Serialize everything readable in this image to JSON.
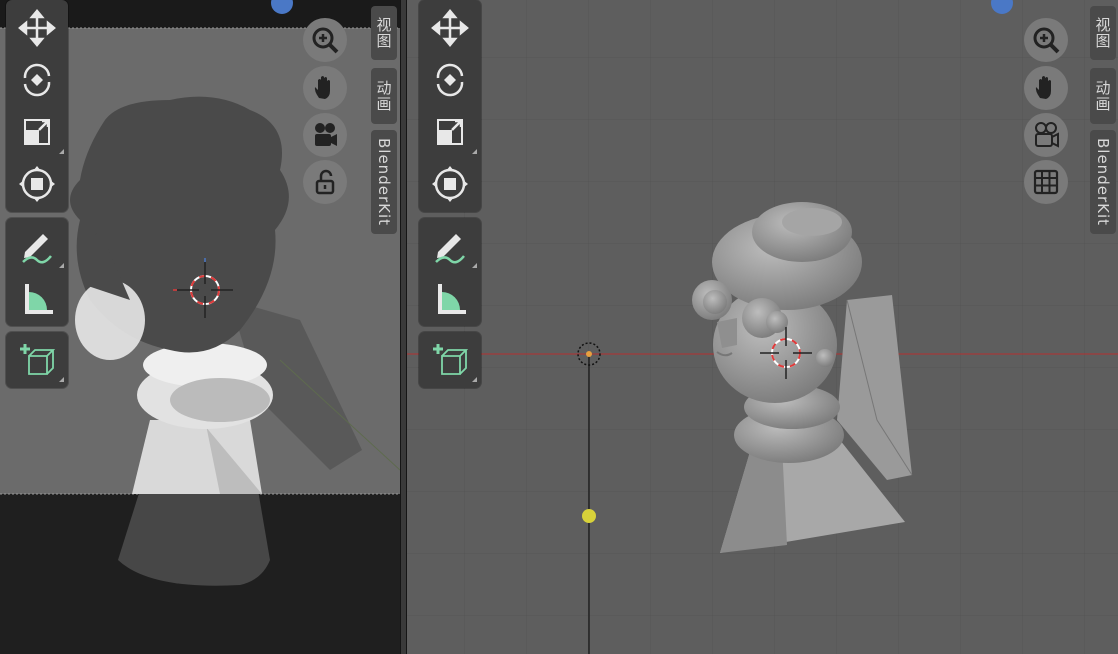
{
  "left_viewport": {
    "tools": [
      "move",
      "rotate",
      "scale",
      "transform",
      "annotate",
      "measure",
      "add-cube"
    ],
    "nav": [
      "zoom",
      "pan",
      "camera",
      "lock"
    ],
    "tabs": {
      "view": "视图",
      "animation": "动画",
      "blenderkit": "BlenderKit"
    }
  },
  "right_viewport": {
    "tools": [
      "move",
      "rotate",
      "scale",
      "transform",
      "annotate",
      "measure",
      "add-cube"
    ],
    "nav": [
      "zoom",
      "pan",
      "camera",
      "grid"
    ],
    "tabs": {
      "view": "视图",
      "animation": "动画",
      "blenderkit": "BlenderKit"
    }
  },
  "colors": {
    "accent_blue": "#4a78c6",
    "tool_green": "#7fd6a8",
    "light_yellow": "#d8d23a",
    "x_axis_red": "#a33a3a",
    "cursor_red": "#e03a3a"
  }
}
